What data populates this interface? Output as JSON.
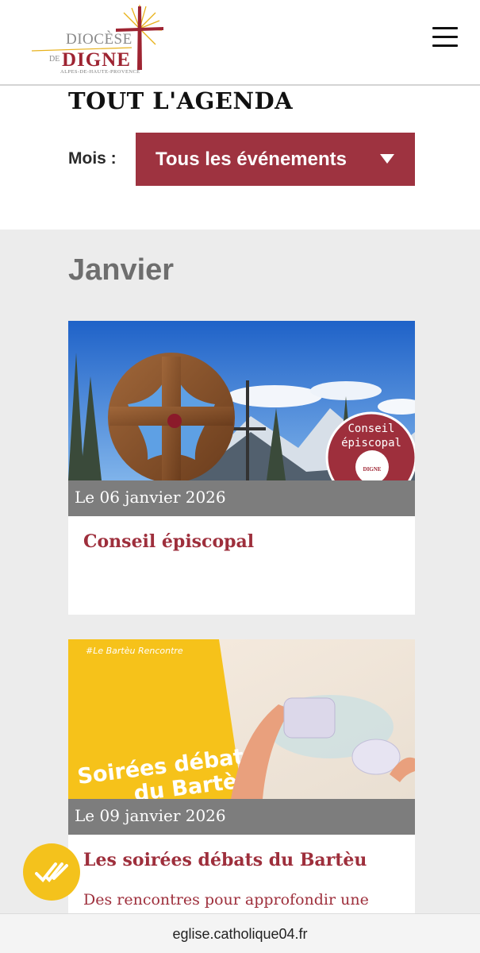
{
  "header": {
    "logo": {
      "line1": "DIOCÈSE",
      "line2_prefix": "DE",
      "line2": "DIGNE",
      "line3": "ALPES-DE-HAUTE-PROVENCE"
    },
    "menu_icon": "hamburger-menu-icon"
  },
  "agenda": {
    "title": "TOUT L'AGENDA",
    "filter_label": "Mois :",
    "filter_value": "Tous les événements"
  },
  "events": {
    "month": "Janvier",
    "items": [
      {
        "date": "Le 06 janvier 2026",
        "title": "Conseil épiscopal",
        "image_badge_line1": "Conseil",
        "image_badge_line2": "épiscopal",
        "image_badge_logo": "DIGNE"
      },
      {
        "date": "Le 09 janvier 2026",
        "title": "Les soirées débats du Bartèu",
        "description": "Des rencontres pour approfondir une",
        "image_tag": "#Le Bartèu Rencontre",
        "image_line1": "Soirées débats",
        "image_line2": "du Bartèu"
      }
    ]
  },
  "fab": {
    "icon": "checkmarks-icon"
  },
  "url_bar": {
    "url": "eglise.catholique04.fr"
  },
  "colors": {
    "brand": "#9e3340",
    "title_red": "#9e2f3c",
    "date_bar": "#7d7d7d",
    "section_bg": "#ececec",
    "fab_yellow": "#f4c21c"
  }
}
